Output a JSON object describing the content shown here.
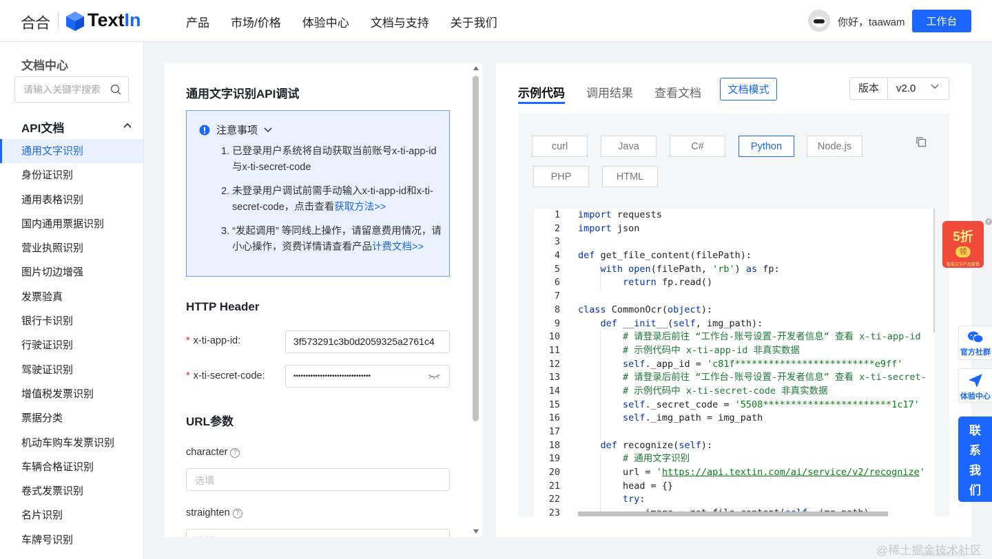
{
  "header": {
    "brand_cn": "合合",
    "brand_name_a": "Text",
    "brand_name_b": "In",
    "nav": [
      "产品",
      "市场/价格",
      "体验中心",
      "文档与支持",
      "关于我们"
    ],
    "greeting": "你好，taawam",
    "workspace_button": "工作台"
  },
  "sidebar": {
    "title": "文档中心",
    "search_placeholder": "请输入关键字搜索",
    "group": "API文档",
    "items": [
      "通用文字识别",
      "身份证识别",
      "通用表格识别",
      "国内通用票据识别",
      "营业执照识别",
      "图片切边增强",
      "发票验真",
      "银行卡识别",
      "行驶证识别",
      "驾驶证识别",
      "增值税发票识别",
      "票据分类",
      "机动车购车发票识别",
      "车辆合格证识别",
      "卷式发票识别",
      "名片识别",
      "车牌号识别"
    ],
    "active_index": 0
  },
  "left_panel": {
    "title": "通用文字识别API调试",
    "notice": {
      "heading": "注意事项",
      "item1": "1. 已登录用户系统将自动获取当前账号x-ti-app-id与x-ti-secret-code",
      "item2_text": "2. 未登录用户调试前需手动输入x-ti-app-id和x-ti-secret-code，点击查看",
      "item2_link": "获取方法>>",
      "item3_text": "3. “发起调用” 等同线上操作，请留意费用情况，请小心操作，资费详情请查看产品",
      "item3_link": "计费文档>>"
    },
    "http_header_title": "HTTP Header",
    "app_id_label": "x-ti-app-id:",
    "app_id_value": "3f573291c3b0d2059325a2761c4",
    "secret_label": "x-ti-secret-code:",
    "secret_value": "••••••••••••••••••••••••••••••••",
    "url_params_title": "URL参数",
    "param1_label": "character",
    "param2_label": "straighten",
    "param_placeholder": "选填"
  },
  "right_panel": {
    "tabs": [
      "示例代码",
      "调用结果",
      "查看文档"
    ],
    "active_tab": 0,
    "doc_mode_button": "文档模式",
    "version_label": "版本",
    "version_value": "v2.0",
    "languages": [
      "curl",
      "Java",
      "C#",
      "Python",
      "Node.js",
      "PHP",
      "HTML"
    ],
    "active_language": "Python",
    "code_line_numbers": [
      "1",
      "2",
      "3",
      "4",
      "5",
      "6",
      "7",
      "8",
      "9",
      "10",
      "11",
      "12",
      "13",
      "14",
      "15",
      "16",
      "17",
      "18",
      "19",
      "20",
      "21",
      "22",
      "23"
    ]
  },
  "float": {
    "promo_big": "5折",
    "promo_badge": "领",
    "promo_small": "智能文字产品套餐",
    "group_label": "官方社群",
    "experience_label": "体验中心",
    "contact_chars": [
      "联",
      "系",
      "我",
      "们"
    ]
  },
  "watermark": "@稀土掘金技术社区",
  "watermark_small": "@稀土掘金技术社区",
  "colors": {
    "accent": "#1a66ff",
    "notice_bg": "#eaf2ff",
    "required": "#f5222d"
  }
}
